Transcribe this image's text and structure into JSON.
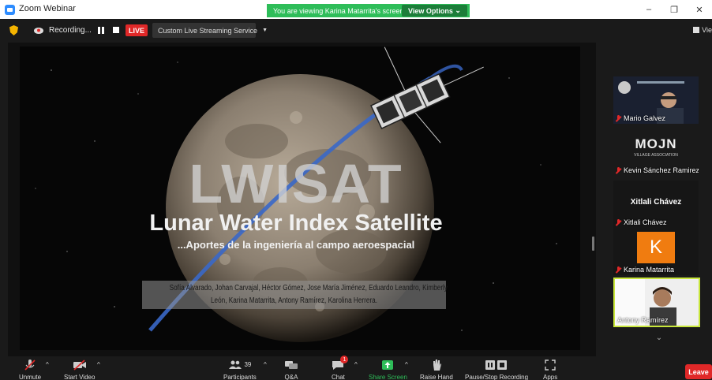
{
  "window": {
    "title": "Zoom Webinar",
    "controls": [
      "–",
      "❐",
      "✕"
    ]
  },
  "banner": {
    "viewing_text": "You are viewing Karina Matarrita's screen",
    "view_options": "View Options"
  },
  "meeting_bar": {
    "recording_label": "Recording...",
    "live_badge": "LIVE",
    "stream_service": "Custom Live Streaming Service",
    "view_label": "Vie"
  },
  "slide": {
    "title": "LWISAT",
    "subtitle": "Lunar Water Index Satellite",
    "tagline": "...Aportes de la ingeniería al campo aeroespacial",
    "authors_line1": "Sofía Alvarado, Johan Carvajal, Héctor Gómez, Jose María Jiménez, Eduardo Leandro, Kimberly",
    "authors_line2": "León, Karina Matarrita, Antony Ramírez, Karolina Herrera."
  },
  "gallery": {
    "participants": [
      {
        "name": "Mario Galvez",
        "muted": true
      },
      {
        "name": "Kevin Sánchez Ramirez",
        "muted": true,
        "logo_text": "MOJN",
        "logo_sub": "VILLAGE ASSOCIATION"
      },
      {
        "name": "Xitlali Chávez",
        "muted": true,
        "display_text": "Xitlali Chávez"
      },
      {
        "name": "Karina Matarrita",
        "muted": true,
        "avatar_letter": "K"
      },
      {
        "name": "Antony Ramírez",
        "muted": false
      }
    ],
    "scroll_label": "⌄"
  },
  "toolbar": {
    "unmute": "Unmute",
    "start_video": "Start Video",
    "participants": "Participants",
    "participant_count": "39",
    "qa": "Q&A",
    "chat": "Chat",
    "chat_badge": "1",
    "share_screen": "Share Screen",
    "raise_hand": "Raise Hand",
    "pause_stop_recording": "Pause/Stop Recording",
    "apps": "Apps",
    "leave": "Leave"
  },
  "colors": {
    "zoom_blue": "#2d8cff",
    "banner_green": "#2ebd59",
    "live_red": "#e02828",
    "active_speaker_border": "#c8e63c",
    "avatar_orange": "#f07c10"
  }
}
